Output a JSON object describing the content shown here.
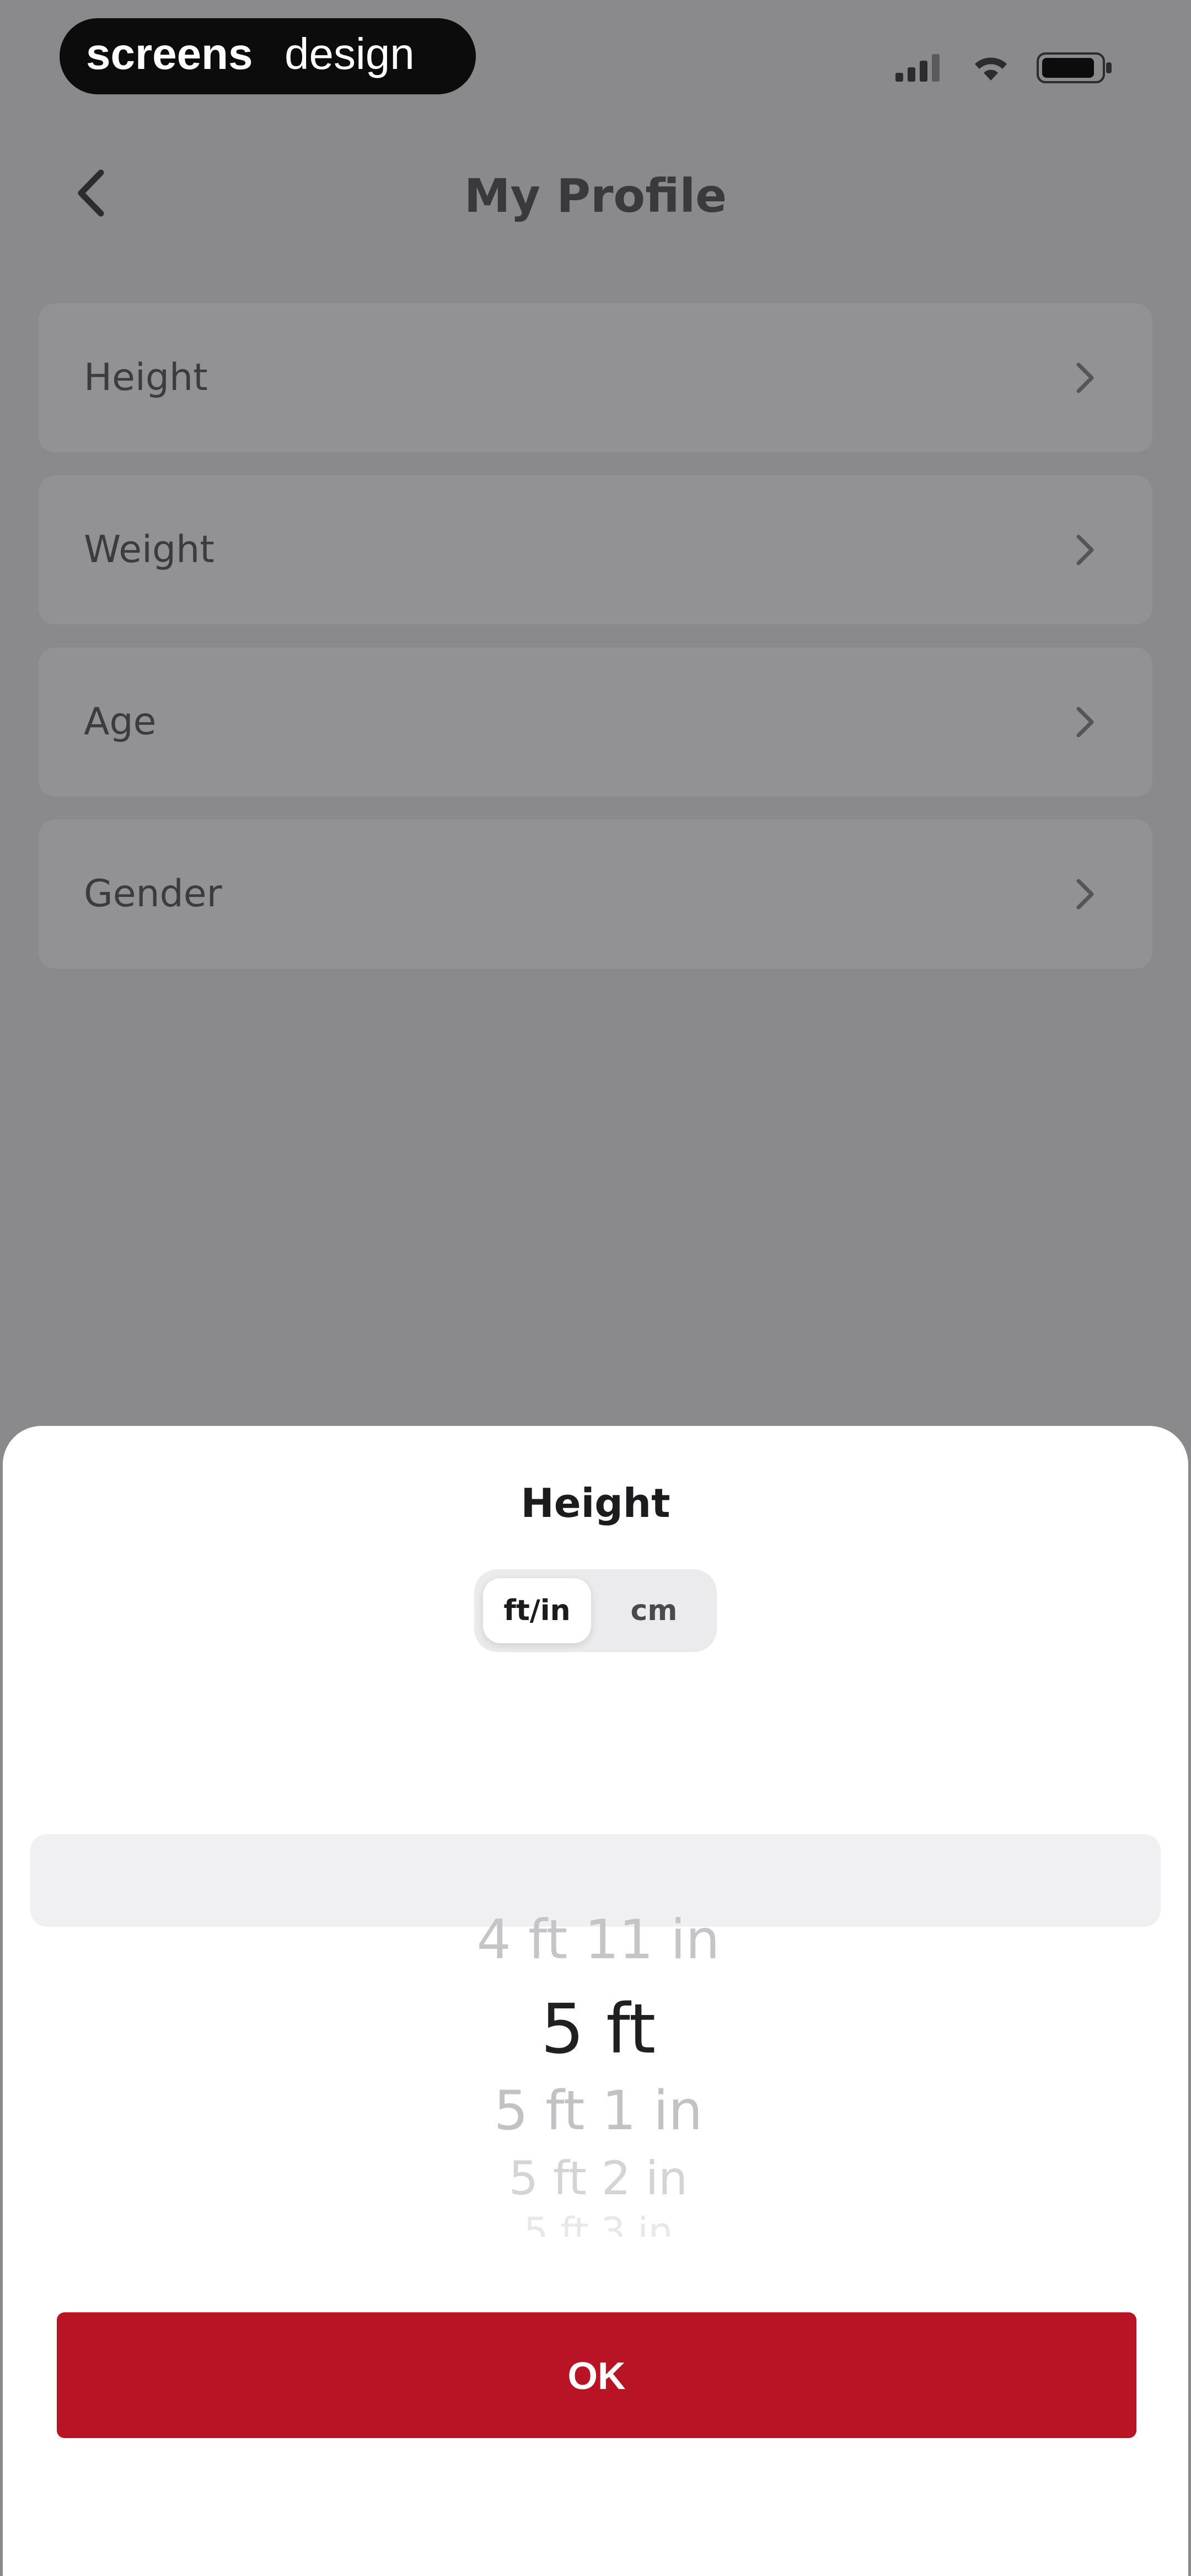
{
  "watermark": {
    "text_bold": "screens",
    "text_light": "design"
  },
  "header": {
    "title": "My Profile",
    "back_icon": "chevron-left-icon"
  },
  "profile_items": [
    {
      "label": "Height",
      "icon": "chevron-right-icon"
    },
    {
      "label": "Weight",
      "icon": "chevron-right-icon"
    },
    {
      "label": "Age",
      "icon": "chevron-right-icon"
    },
    {
      "label": "Gender",
      "icon": "chevron-right-icon"
    }
  ],
  "sheet": {
    "title": "Height",
    "units": [
      {
        "label": "ft/in",
        "selected": true
      },
      {
        "label": "cm",
        "selected": false
      }
    ],
    "picker": {
      "items": [
        "4 ft 11 in",
        "5 ft",
        "5 ft 1 in",
        "5 ft 2 in",
        "5 ft 3 in"
      ],
      "selected": "5 ft"
    },
    "ok_label": "OK"
  },
  "colors": {
    "accent": "#b81425",
    "overlay": "#8a8a8c",
    "sheet_bg": "#ffffff"
  }
}
